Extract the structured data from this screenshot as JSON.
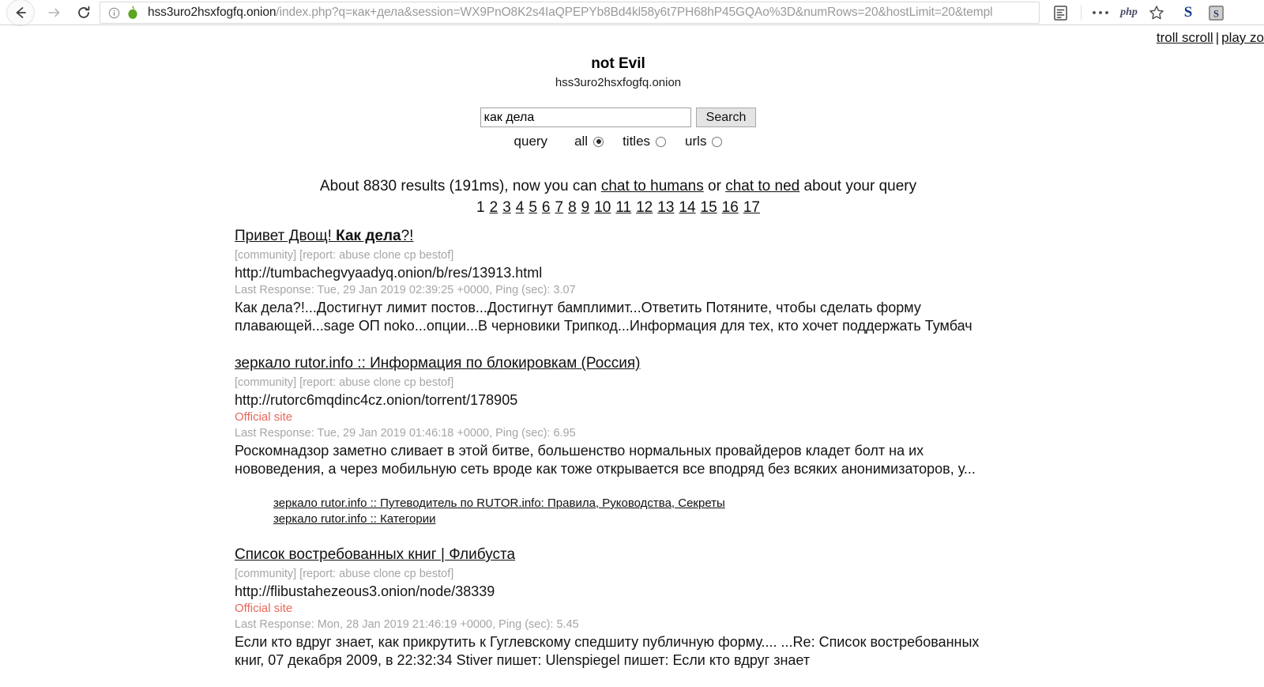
{
  "browser": {
    "back_label": "Back",
    "forward_label": "Forward",
    "reload_label": "Reload",
    "url_host": "hss3uro2hsxfogfq.onion",
    "url_path": "/index.php?q=как+дела&session=WX9PnO8K2s4IaQPEPYb8Bd4kl58y6t7PH68hP45GQAo%3D&numRows=20&hostLimit=20&templ",
    "php_badge": "php",
    "s_badge": "S",
    "icons": {
      "info": "info-icon",
      "onion": "onion-icon",
      "reader": "reader-view-icon",
      "menu": "overflow-menu-icon",
      "star": "bookmark-star-icon",
      "s_gray": "s-extension-icon"
    }
  },
  "topbar": {
    "troll_scroll": "troll scroll",
    "separator": "|",
    "play_zone": "play zo"
  },
  "header": {
    "title": "not Evil",
    "domain": "hss3uro2hsxfogfq.onion"
  },
  "search": {
    "value": "как дела",
    "placeholder": "",
    "button_label": "Search",
    "query_label": "query",
    "options": [
      {
        "label": "all",
        "checked": true
      },
      {
        "label": "titles",
        "checked": false
      },
      {
        "label": "urls",
        "checked": false
      }
    ]
  },
  "results_meta": {
    "prefix": "About 8830 results (191ms), now you can ",
    "link1": "chat to humans",
    "middle": " or ",
    "link2": "chat to ned",
    "suffix": " about your query"
  },
  "pager": {
    "current": "1",
    "pages": [
      "2",
      "3",
      "4",
      "5",
      "6",
      "7",
      "8",
      "9",
      "10",
      "11",
      "12",
      "13",
      "14",
      "15",
      "16",
      "17"
    ]
  },
  "results": [
    {
      "title_plain": "Привет Двощ! ",
      "title_bold": "Как дела",
      "title_tail": "?!",
      "tags": "[community] [report: abuse clone cp bestof]",
      "url": "http://tumbachegvyaadyq.onion/b/res/13913.html",
      "official": "",
      "response": "Last Response: Tue, 29 Jan 2019 02:39:25 +0000, Ping (sec): 3.07",
      "snippet": "Как дела?!...Достигнут лимит постов...Достигнут бамплимит...Ответить Потяните, чтобы сделать форму плавающей...sage ОП noko...опции...В черновики Трипкод...Информация для тех, кто хочет поддержать Тумбач",
      "sublinks": []
    },
    {
      "title_plain": "зеркало rutor.info :: Информация по блокировкам (Россия)",
      "title_bold": "",
      "title_tail": "",
      "tags": "[community] [report: abuse clone cp bestof]",
      "url": "http://rutorc6mqdinc4cz.onion/torrent/178905",
      "official": "Official site",
      "response": "Last Response: Tue, 29 Jan 2019 01:46:18 +0000, Ping (sec): 6.95",
      "snippet": "Роскомнадзор заметно сливает в этой битве, большенство нормальных провайдеров кладет болт на их нововедения, а через мобильную сеть вроде как тоже открывается все вподряд без всяких анонимизаторов, у...",
      "sublinks": [
        "зеркало rutor.info :: Путеводитель по RUTOR.info: Правила, Руководства, Секреты",
        "зеркало rutor.info :: Категории"
      ]
    },
    {
      "title_plain": "Список востребованных книг | Флибуста",
      "title_bold": "",
      "title_tail": "",
      "tags": "[community] [report: abuse clone cp bestof]",
      "url": "http://flibustahezeous3.onion/node/38339",
      "official": "Official site",
      "response": "Last Response: Mon, 28 Jan 2019 21:46:19 +0000, Ping (sec): 5.45",
      "snippet": "Если кто вдруг знает, как прикрутить к Гуглевскому спедшиту публичную форму.... ...Re: Список востребованных книг, 07 декабря 2009, в 22:32:34 Stiver пишет:   Ulenspiegel пишет:   Если кто вдруг знает",
      "sublinks": []
    }
  ],
  "colors": {
    "link": "#111111",
    "url": "#141414",
    "muted": "#a6a6a6",
    "official": "#e8675a",
    "chrome_border": "#d9d9d9",
    "onion_green": "#5fa521"
  }
}
